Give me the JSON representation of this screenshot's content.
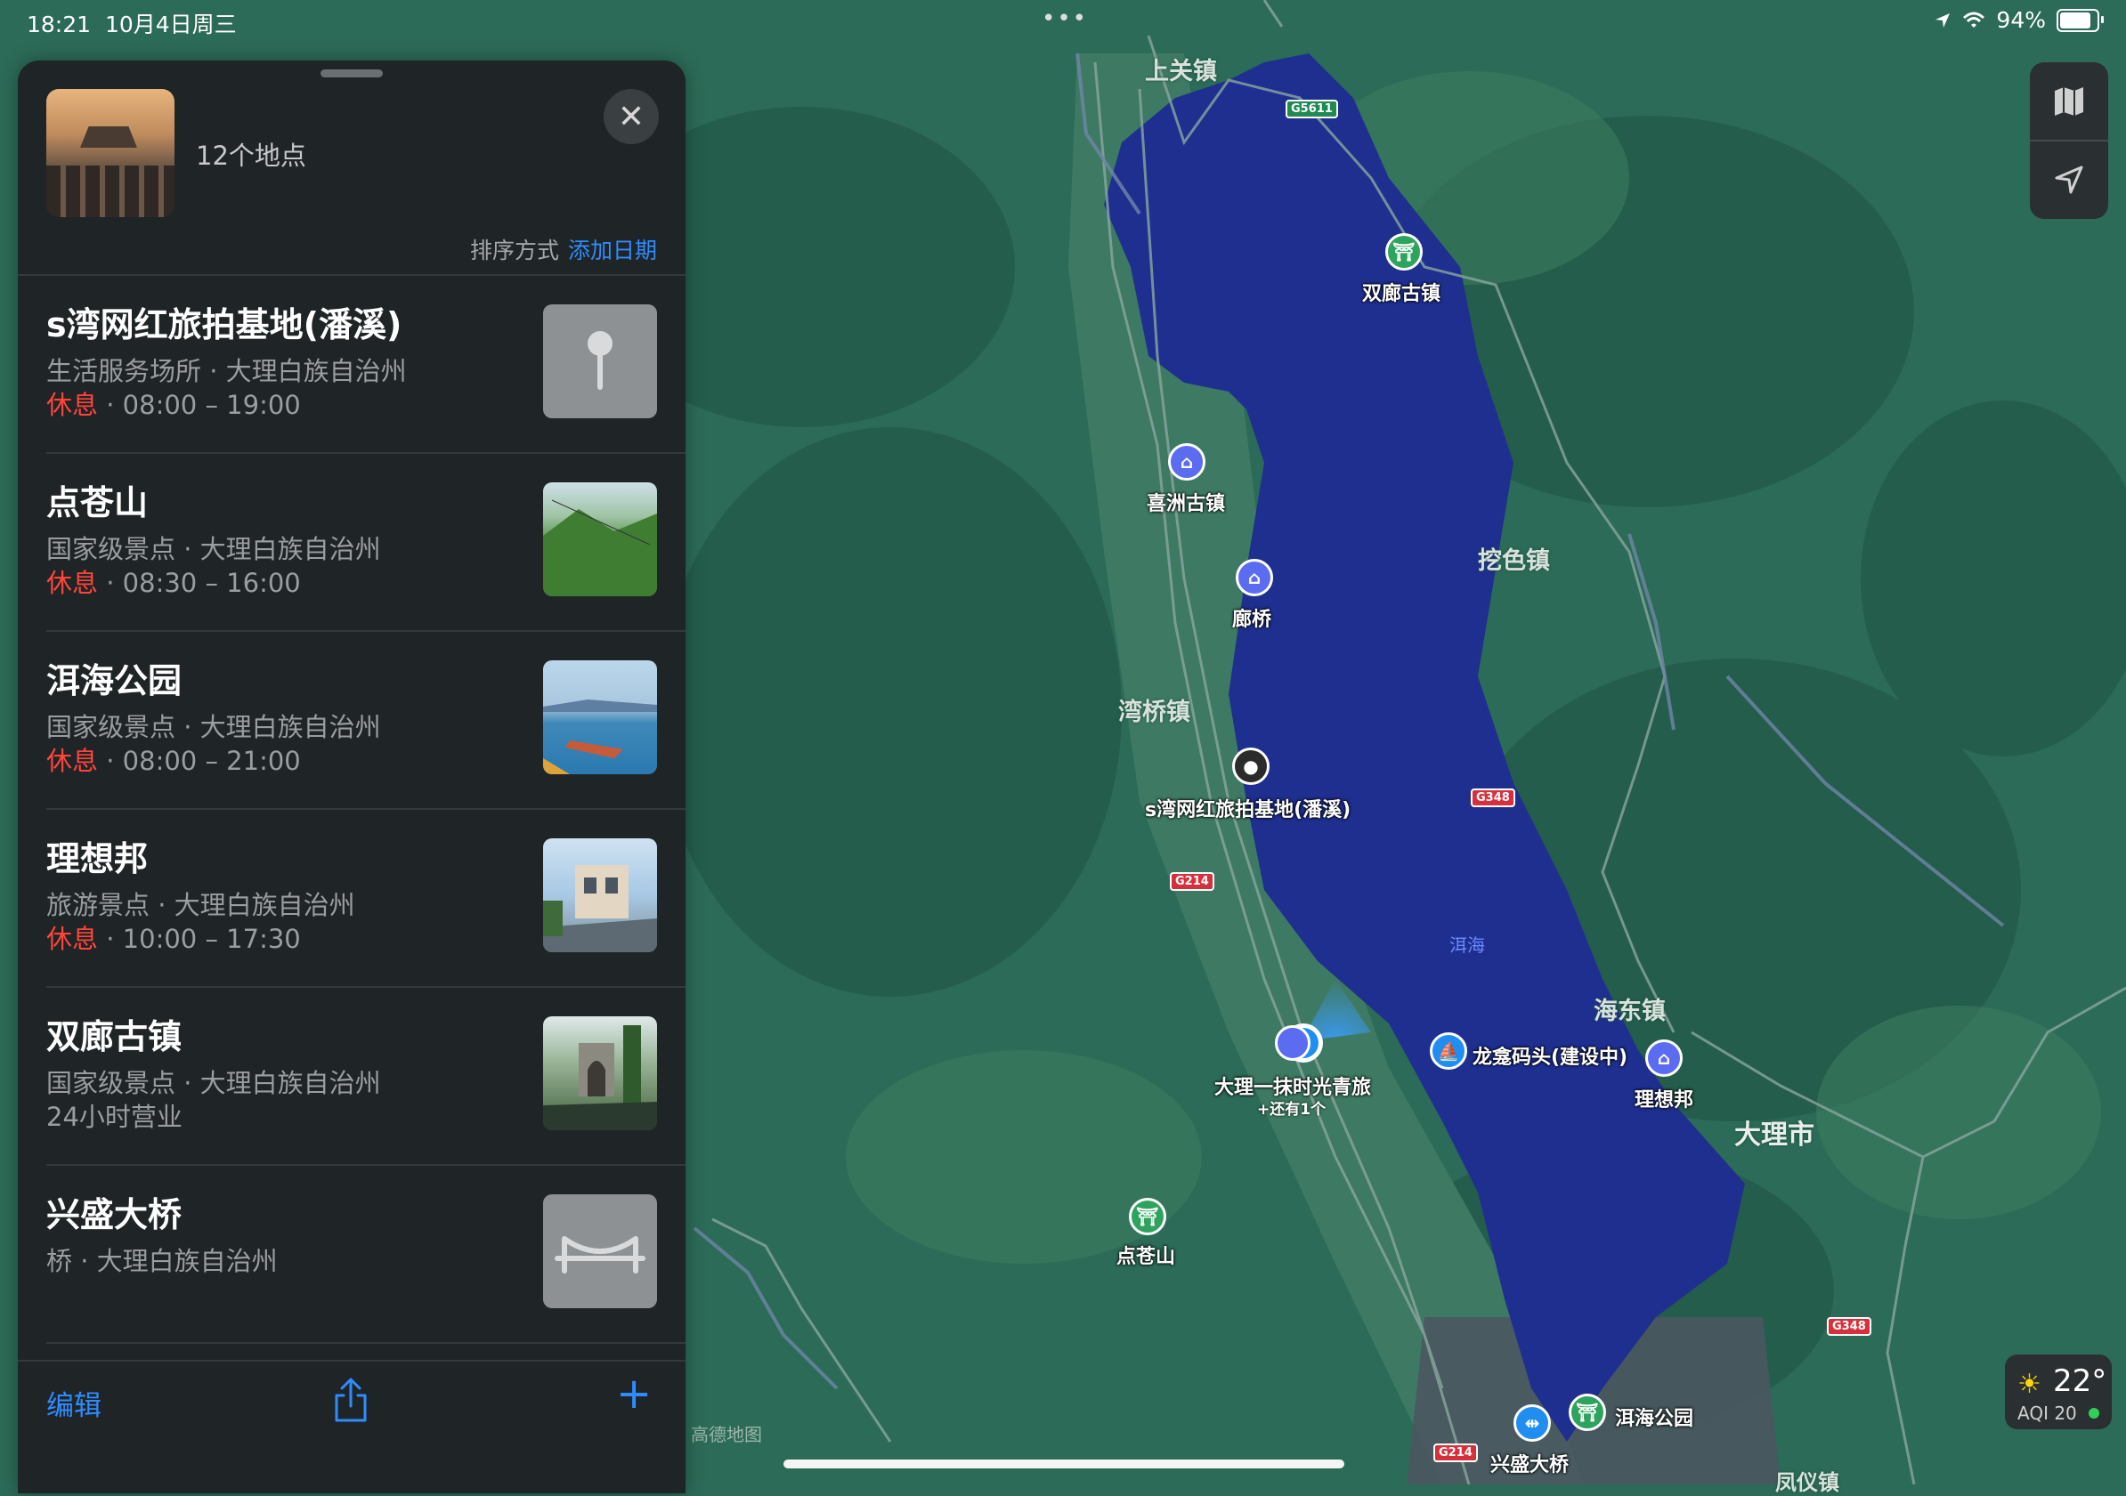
{
  "status_bar": {
    "time": "18:21",
    "date": "10月4日周三",
    "battery": "94%",
    "battery_level": 0.94
  },
  "sidebar": {
    "count_label": "12个地点",
    "sort_label": "排序方式",
    "add_date_label": "添加日期",
    "items": [
      {
        "title": "s湾网红旅拍基地(潘溪)",
        "subtitle": "生活服务场所 · 大理白族自治州",
        "status": "休息",
        "hours": " · 08:00 – 19:00",
        "thumb_icon": "location-pin-icon"
      },
      {
        "title": "点苍山",
        "subtitle": "国家级景点 · 大理白族自治州",
        "status": "休息",
        "hours": " · 08:30 – 16:00",
        "thumb_icon": "mountain-photo"
      },
      {
        "title": "洱海公园",
        "subtitle": "国家级景点 · 大理白族自治州",
        "status": "休息",
        "hours": " · 08:00 – 21:00",
        "thumb_icon": "lake-photo"
      },
      {
        "title": "理想邦",
        "subtitle": "旅游景点 · 大理白族自治州",
        "status": "休息",
        "hours": " · 10:00 – 17:30",
        "thumb_icon": "building-photo"
      },
      {
        "title": "双廊古镇",
        "subtitle": "国家级景点 · 大理白族自治州",
        "status": "",
        "hours": "24小时营业",
        "thumb_icon": "town-photo"
      },
      {
        "title": "兴盛大桥",
        "subtitle": "桥 · 大理白族自治州",
        "status": "",
        "hours": "",
        "thumb_icon": "bridge-icon"
      }
    ],
    "footer": {
      "edit_label": "编辑",
      "share_icon": "share-icon",
      "add_icon": "plus-icon"
    }
  },
  "map": {
    "towns": [
      "上关镇",
      "挖色镇",
      "湾桥镇",
      "海东镇",
      "大理市",
      "凤仪镇"
    ],
    "lake": "洱海",
    "pois": {
      "shuanglang": "双廊古镇",
      "xizhou": "喜洲古镇",
      "langqiao": "廊桥",
      "swan": "s湾网红旅拍基地(潘溪)",
      "hostel": "大理一抹时光青旅",
      "hostel_more": "+还有1个",
      "longkan": "龙龛码头(建设中)",
      "lixiangbang": "理想邦",
      "diancang": "点苍山",
      "erhai_park": "洱海公园",
      "xingsheng": "兴盛大桥"
    },
    "shields": {
      "g5611": "G5611",
      "g348a": "G348",
      "g214a": "G214",
      "g348b": "G348",
      "g214b": "G214"
    },
    "watermark": "高德地图"
  },
  "weather": {
    "temp": "22°",
    "aqi": "AQI 20",
    "icon": "sun-icon"
  },
  "colors": {
    "accent": "#2f8cff",
    "closed": "#ff453a",
    "lake": "#1f2f8f",
    "land": "#2c6b57",
    "panel": "#1f2426"
  }
}
